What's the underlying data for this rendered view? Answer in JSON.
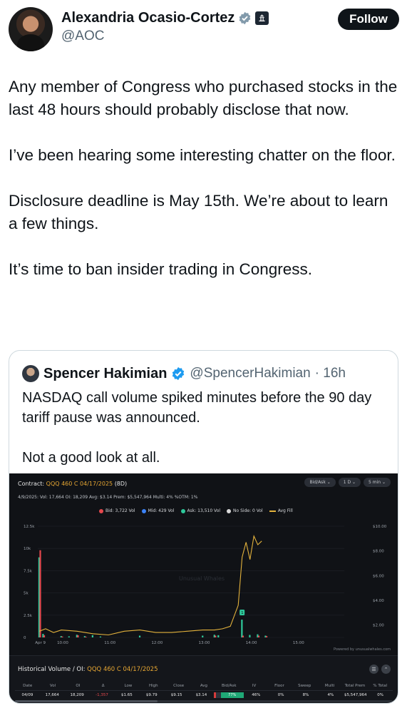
{
  "author": {
    "name": "Alexandria Ocasio-Cortez",
    "handle": "@AOC",
    "follow_label": "Follow"
  },
  "tweet": {
    "paragraphs": [
      "Any member of Congress who purchased stocks in the last 48 hours should probably disclose that now.",
      "I’ve been hearing some interesting chatter on the floor.",
      "Disclosure deadline is May 15th. We’re about to learn a few things.",
      "It’s time to ban insider trading in Congress."
    ]
  },
  "quote": {
    "name": "Spencer Hakimian",
    "handle": "@SpencerHakimian",
    "time": "· 16h",
    "paragraphs": [
      "NASDAQ call volume spiked minutes before the 90 day tariff pause was announced.",
      "Not a good look at all."
    ]
  },
  "chart_card": {
    "contract_label": "Contract:",
    "contract_value": "QQQ 460 C 04/17/2025",
    "contract_days": "(8D)",
    "stats": "4/9/2025:  Vol: 17,664   OI: 18,209   Avg: $3.14   Prem: $5,547,964   Multi: 4%   %OTM: 1%",
    "controls": [
      "Bid/Ask ⌄",
      "1 D ⌄",
      "5 min ⌄"
    ],
    "legend": [
      "Bid: 3,722 Vol",
      "Mid: 429 Vol",
      "Ask: 13,510 Vol",
      "No Side: 0 Vol",
      "Avg Fill"
    ],
    "watermark": "Unusual Whales",
    "powered": "Powered by unusualwhales.com",
    "colors": {
      "bid": "#e5484d",
      "mid": "#3b82f6",
      "ask": "#2ec99b",
      "noside": "#d9d9d9",
      "avgfill": "#e3b23c"
    }
  },
  "chart_data": {
    "type": "bar",
    "title": "QQQ 460 C 04/17/2025",
    "x_ticks": [
      "Apr 9",
      "10:00",
      "11:00",
      "12:00",
      "13:00",
      "14:00",
      "15:00"
    ],
    "y_left_ticks": [
      "0",
      "2.5k",
      "5k",
      "7.5k",
      "10k",
      "12.5k"
    ],
    "y_right_ticks": [
      "$2.00",
      "$4.00",
      "$6.00",
      "$8.00",
      "$10.00"
    ],
    "ylim_volume": [
      0,
      12500
    ],
    "ylim_price": [
      1.0,
      10.0
    ],
    "x_range_minutes": [
      570,
      960
    ],
    "volume_bars": [
      {
        "t": 572,
        "ask": 9000,
        "bid": 9800
      },
      {
        "t": 577,
        "ask": 400,
        "bid": 250
      },
      {
        "t": 600,
        "ask": 150,
        "bid": 100
      },
      {
        "t": 610,
        "ask": 120,
        "bid": 0
      },
      {
        "t": 620,
        "ask": 300,
        "bid": 250
      },
      {
        "t": 630,
        "ask": 150,
        "bid": 80
      },
      {
        "t": 640,
        "ask": 250,
        "bid": 0
      },
      {
        "t": 650,
        "ask": 100,
        "bid": 0
      },
      {
        "t": 700,
        "ask": 200,
        "bid": 0
      },
      {
        "t": 780,
        "ask": 200,
        "bid": 0
      },
      {
        "t": 795,
        "ask": 300,
        "bid": 200
      },
      {
        "t": 800,
        "ask": 250,
        "bid": 0
      },
      {
        "t": 830,
        "ask": 2000,
        "bid": 200
      },
      {
        "t": 840,
        "ask": 280,
        "bid": 0
      },
      {
        "t": 850,
        "ask": 350,
        "bid": 200
      },
      {
        "t": 860,
        "ask": 200,
        "bid": 150
      }
    ],
    "avg_fill": [
      {
        "t": 572,
        "p": 1.5
      },
      {
        "t": 580,
        "p": 1.7
      },
      {
        "t": 590,
        "p": 1.4
      },
      {
        "t": 600,
        "p": 1.6
      },
      {
        "t": 620,
        "p": 1.5
      },
      {
        "t": 640,
        "p": 1.3
      },
      {
        "t": 660,
        "p": 1.2
      },
      {
        "t": 680,
        "p": 1.5
      },
      {
        "t": 700,
        "p": 1.6
      },
      {
        "t": 720,
        "p": 1.4
      },
      {
        "t": 740,
        "p": 1.4
      },
      {
        "t": 760,
        "p": 1.5
      },
      {
        "t": 780,
        "p": 1.6
      },
      {
        "t": 795,
        "p": 1.6
      },
      {
        "t": 805,
        "p": 1.7
      },
      {
        "t": 815,
        "p": 1.9
      },
      {
        "t": 825,
        "p": 3.6
      },
      {
        "t": 830,
        "p": 7.5
      },
      {
        "t": 835,
        "p": 8.7
      },
      {
        "t": 840,
        "p": 7.3
      },
      {
        "t": 845,
        "p": 9.2
      },
      {
        "t": 850,
        "p": 8.5
      },
      {
        "t": 855,
        "p": 8.8
      }
    ],
    "annotation_marker": "1"
  },
  "historical": {
    "title": "Historical Volume / OI:",
    "contract": "QQQ 460 C 04/17/2025",
    "headers": [
      "Date",
      "Vol",
      "OI",
      "Δ",
      "Low",
      "High",
      "Close",
      "Avg",
      "Bid/Ask",
      "IV",
      "Floor",
      "Sweep",
      "Multi",
      "Total Prem",
      "% Total"
    ],
    "row": [
      "04/09",
      "17,664",
      "18,209",
      "-1,357",
      "$1.65",
      "$9.79",
      "$9.15",
      "$3.14",
      "77%",
      "46%",
      "0%",
      "8%",
      "4%",
      "$5,547,964",
      "0%"
    ],
    "powered": "Powered by unusualwhales.com"
  }
}
